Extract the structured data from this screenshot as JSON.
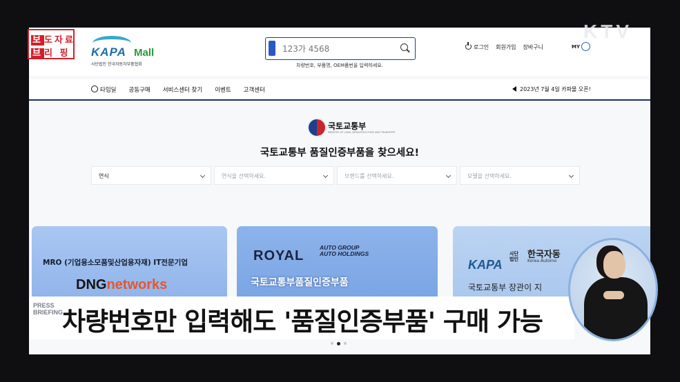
{
  "overlay": {
    "brief_row1_a": "보",
    "brief_row1_b": "도자료",
    "brief_row2_a": "브",
    "brief_row2_b": "리 핑",
    "channel": "KTV",
    "press_line1": "PRESS",
    "press_line2": "BRIEFING",
    "caption": "차량번호만 입력해도 '품질인증부품' 구매 가능"
  },
  "header": {
    "logo_main": "KAPA",
    "logo_mall": "Mall",
    "logo_sub": "사단법인 한국자동차부품협회",
    "search_placeholder": "123가 4568",
    "search_hint": "차량번호, 부품명, OEM품번을 입력하세요.",
    "nav": [
      "로그인",
      "회원가입",
      "장바구니"
    ],
    "my": "MY"
  },
  "menu": {
    "items": [
      "타임딜",
      "공동구매",
      "서비스센터 찾기",
      "이벤트",
      "고객센터"
    ],
    "notice": "2023년 7월 4일 카파몰 오픈!"
  },
  "main": {
    "ministry": "국토교통부",
    "ministry_en": "MINISTRY OF LAND, INFRASTRUCTURE AND TRANSPORT",
    "heading": "국토교통부 품질인증부품을 찾으세요!",
    "selects": [
      "연식",
      "연식을 선택하세요.",
      "브랜드를 선택하세요.",
      "모델을 선택하세요."
    ]
  },
  "banners": {
    "b1_line": "MRO (기업용소모품및산업용자재) IT전문기업",
    "b1_dng": "DNG",
    "b1_networks": "networks",
    "b2_royal": "ROYAL",
    "b2_group1": "AUTO GROUP",
    "b2_group2": "AUTO HOLDINGS",
    "b2_quality": "국토교통부품질인증부품",
    "b3_kapa": "KAPA",
    "b3_assoc1": "사단",
    "b3_assoc2": "법인",
    "b3_name": "한국자동",
    "b3_en": "Korea Automo",
    "b3_line": "국토교통부 장관이 지"
  },
  "colors": {
    "brand_blue": "#1c3f7a",
    "accent_red": "#d21f2a",
    "mall_green": "#2a9a3a"
  }
}
